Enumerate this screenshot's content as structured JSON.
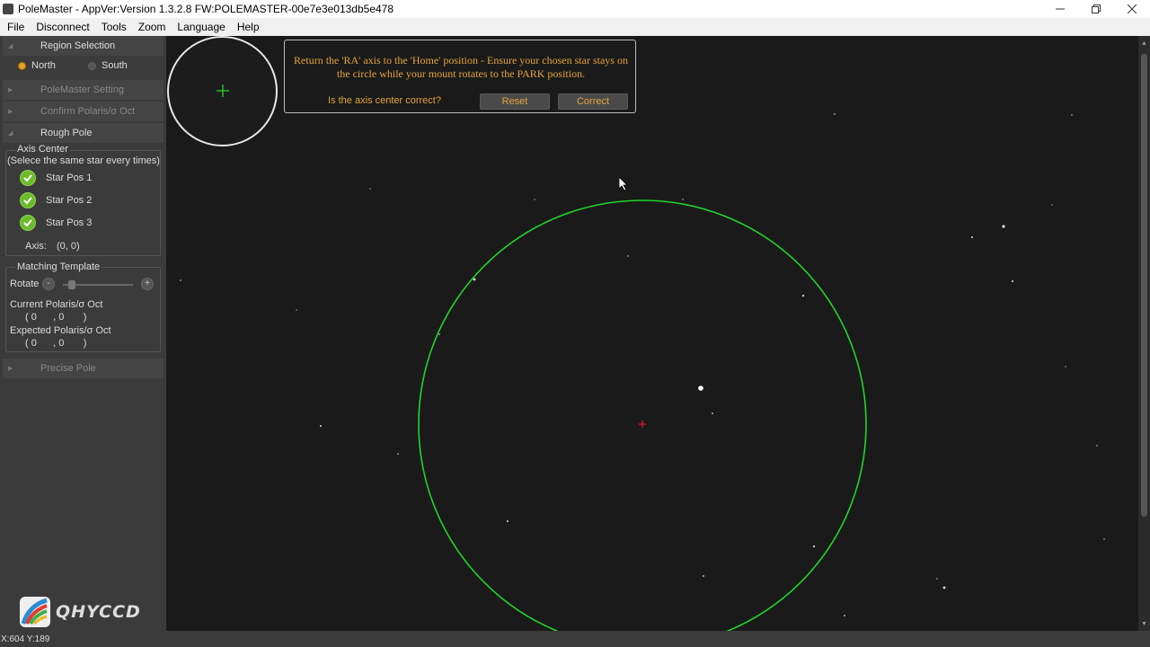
{
  "window": {
    "title": "PoleMaster - AppVer:Version 1.3.2.8 FW:POLEMASTER-00e7e3e013db5e478",
    "controls": [
      "minimize",
      "restore",
      "close"
    ]
  },
  "menu": [
    "File",
    "Disconnect",
    "Tools",
    "Zoom",
    "Language",
    "Help"
  ],
  "sidebar": {
    "region_selection": "Region Selection",
    "north": "North",
    "south": "South",
    "selected_region": "North",
    "polemaster_setting": "PoleMaster Setting",
    "confirm_polaris": "Confirm Polaris/σ Oct",
    "rough_pole": "Rough Pole",
    "axis_center": {
      "title": "Axis Center",
      "subtitle": "(Selece the same star every times)",
      "stars": [
        "Star Pos 1",
        "Star Pos 2",
        "Star Pos 3"
      ],
      "axis_label": "Axis:",
      "axis_value": "(0, 0)"
    },
    "matching_template": {
      "title": "Matching Template",
      "rotate_label": "Rotate",
      "minus": "-",
      "plus": "+",
      "rotate_value": 0.1,
      "current_label": "Current Polaris/σ Oct",
      "current_value": "( 0      , 0       )",
      "expected_label": "Expected Polaris/σ Oct",
      "expected_value": "( 0      , 0       )"
    },
    "precise_pole": "Precise Pole",
    "logo_text": "QHYCCD"
  },
  "dialog": {
    "line1": "Return the 'RA' axis to the 'Home' position - Ensure your chosen star stays on",
    "line2": "the circle while your mount rotates to the PARK position.",
    "question": "Is the axis center correct?",
    "reset": "Reset",
    "correct": "Correct"
  },
  "status": {
    "coords": "X:604 Y:189"
  },
  "colors": {
    "guide_circle": "#22d32a",
    "center_marker": "#d0102a",
    "dialog_text": "#e2a53a",
    "panel_bg": "#3b3b3b",
    "sky_bg": "#1a1a1a"
  }
}
